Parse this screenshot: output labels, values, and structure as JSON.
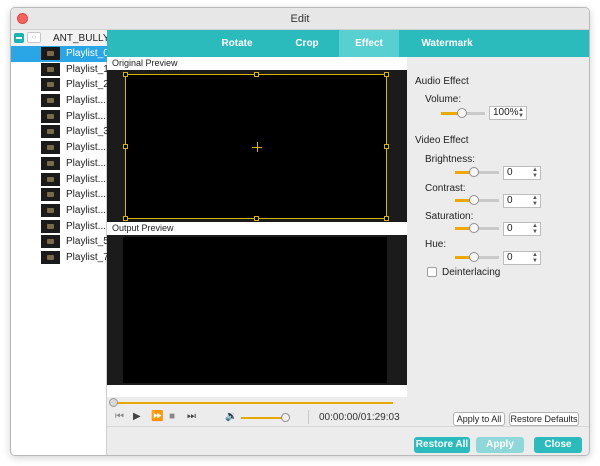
{
  "window": {
    "title": "Edit"
  },
  "playlist": {
    "root_label": "ANT_BULLY",
    "items": [
      {
        "label": "Playlist_0",
        "selected": true
      },
      {
        "label": "Playlist_1"
      },
      {
        "label": "Playlist_2"
      },
      {
        "label": "Playlist..."
      },
      {
        "label": "Playlist..."
      },
      {
        "label": "Playlist_3"
      },
      {
        "label": "Playlist..."
      },
      {
        "label": "Playlist..."
      },
      {
        "label": "Playlist..."
      },
      {
        "label": "Playlist..."
      },
      {
        "label": "Playlist..."
      },
      {
        "label": "Playlist..."
      },
      {
        "label": "Playlist_5"
      },
      {
        "label": "Playlist_7"
      }
    ]
  },
  "tabs": [
    {
      "label": "Rotate"
    },
    {
      "label": "Crop"
    },
    {
      "label": "Effect",
      "active": true
    },
    {
      "label": "Watermark"
    }
  ],
  "previews": {
    "original_label": "Original Preview",
    "output_label": "Output Preview"
  },
  "player": {
    "timecode": "00:00:00/01:29:03",
    "seek_fraction": 0.0,
    "volume_fraction": 0.95
  },
  "effects": {
    "audio_title": "Audio Effect",
    "volume_label": "Volume:",
    "volume_value": "100%",
    "volume_fraction": 0.55,
    "video_title": "Video Effect",
    "brightness_label": "Brightness:",
    "brightness_value": "0",
    "contrast_label": "Contrast:",
    "contrast_value": "0",
    "saturation_label": "Saturation:",
    "saturation_value": "0",
    "hue_label": "Hue:",
    "hue_value": "0",
    "deinterlacing_label": "Deinterlacing",
    "deinterlacing_checked": false,
    "apply_all_label": "Apply to All",
    "restore_defaults_label": "Restore Defaults"
  },
  "footer": {
    "restore_all_label": "Restore All",
    "apply_label": "Apply",
    "close_label": "Close"
  },
  "colors": {
    "accent": "#2bbbbd",
    "selection": "#2aa5e6",
    "slider_fill": "#f0a800"
  }
}
